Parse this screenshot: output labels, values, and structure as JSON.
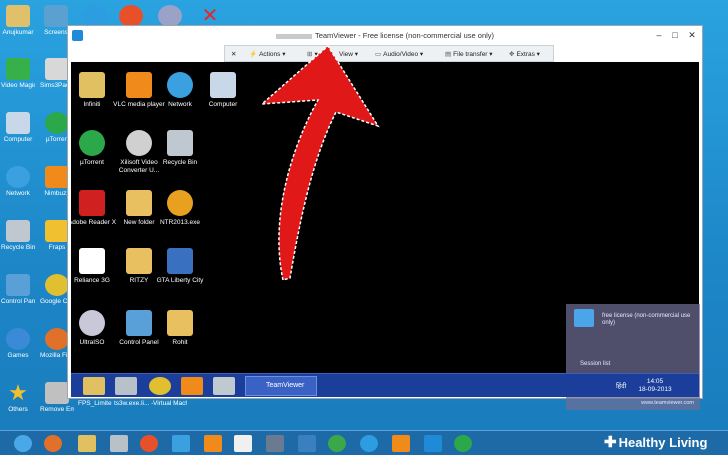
{
  "desktop_icons": [
    {
      "label": "Anujkumar",
      "color": "#e0c06a"
    },
    {
      "label": "Screens",
      "color": "#5aa0d0"
    },
    {
      "label": "",
      "color": "#2b9de0"
    },
    {
      "label": "",
      "color": "#e8502a"
    },
    {
      "label": "",
      "color": "#9aa2c8"
    },
    {
      "label": "",
      "color": "#e02a2a"
    },
    {
      "label": "Video Magic Professional",
      "color": "#36b04a"
    },
    {
      "label": "Sims3Pac Multi Inst",
      "color": "#d8d8d8"
    },
    {
      "label": "Computer",
      "color": "#c8d8e8"
    },
    {
      "label": "µTorren",
      "color": "#2aa84a"
    },
    {
      "label": "Network",
      "color": "#3aa0e0"
    },
    {
      "label": "Nimbuzz",
      "color": "#f08a1a"
    },
    {
      "label": "Recycle Bin",
      "color": "#bfc8d0"
    },
    {
      "label": "Fraps",
      "color": "#f0c030"
    },
    {
      "label": "Control Panel",
      "color": "#5aa0d8"
    },
    {
      "label": "Google Chrome",
      "color": "#e0c030"
    },
    {
      "label": "Games",
      "color": "#3a8ad8"
    },
    {
      "label": "Mozilla Firefox",
      "color": "#e0702a"
    },
    {
      "label": "Others",
      "color": "#f0c030"
    },
    {
      "label": "Remove Empty D...",
      "color": "#c0c0c0"
    },
    {
      "label": "FPS_Limite...",
      "color": "#d0d0d0"
    },
    {
      "label": "ts3w.exe.li... - Shortcut",
      "color": "#d0d0d0"
    },
    {
      "label": "Virtual Machines",
      "color": "#c0c8d0"
    }
  ],
  "window": {
    "title": "TeamViewer - Free license (non-commercial use only)",
    "minimize": "–",
    "maximize": "□",
    "close": "✕"
  },
  "toolbar": {
    "close": "✕",
    "actions": "Actions ▾",
    "view": "View ▾",
    "audio_video": "Audio/Video ▾",
    "file_transfer": "File transfer ▾",
    "extras": "Extras ▾"
  },
  "remote_icons": [
    {
      "label": "Infiniti",
      "color": "#e0c060"
    },
    {
      "label": "VLC media player",
      "color": "#f08a1a"
    },
    {
      "label": "Network",
      "color": "#3aa0e0"
    },
    {
      "label": "Computer",
      "color": "#c8d8e8"
    },
    {
      "label": "µTorrent",
      "color": "#2aa84a"
    },
    {
      "label": "Xilisoft Video Converter U...",
      "color": "#d0d0d0"
    },
    {
      "label": "Recycle Bin",
      "color": "#bfc8d0"
    },
    {
      "label": "Adobe Reader X",
      "color": "#d02020"
    },
    {
      "label": "New folder",
      "color": "#e8c060"
    },
    {
      "label": "NTR2013.exe",
      "color": "#e8a020"
    },
    {
      "label": "Reliance 3G",
      "color": "#ffffff"
    },
    {
      "label": "RITZY",
      "color": "#e8c060"
    },
    {
      "label": "GTA Liberty City",
      "color": "#3a70c0"
    },
    {
      "label": "UltraISO",
      "color": "#c8c8d8"
    },
    {
      "label": "Control Panel",
      "color": "#5aa0d8"
    },
    {
      "label": "Rohit",
      "color": "#e8c060"
    }
  ],
  "remote_taskbar": {
    "teamviewer_label": "TeamViewer",
    "language": "हिंदी",
    "time": "14:05",
    "date": "18-09-2013"
  },
  "overlay": {
    "text": "free license (non-commercial use only)",
    "session_list": "Session list",
    "url": "www.teamviewer.com"
  },
  "brand": {
    "name": "Healthy Living",
    "plus": "✚"
  },
  "colors": {
    "desktop": "#1d87c8",
    "remote_bg": "#000000",
    "arrow": "#e01818"
  }
}
